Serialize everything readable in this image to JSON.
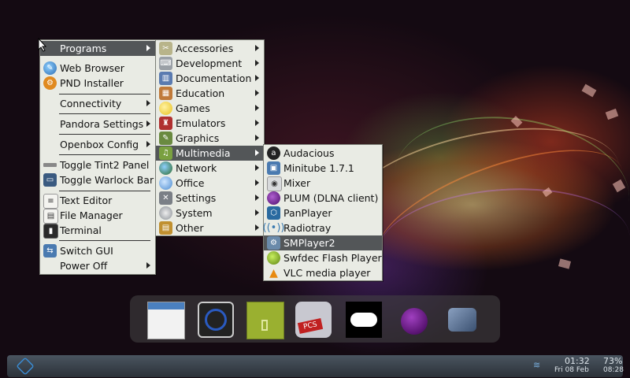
{
  "main_menu": {
    "items": [
      {
        "label": "Programs",
        "icon": "programs-icon",
        "submenu": true
      },
      {
        "label": "Web Browser",
        "icon": "web-browser-icon"
      },
      {
        "label": "PND Installer",
        "icon": "pnd-installer-icon"
      },
      {
        "label": "Connectivity",
        "submenu": true
      },
      {
        "label": "Pandora Settings",
        "submenu": true
      },
      {
        "label": "Openbox Config",
        "submenu": true
      },
      {
        "label": "Toggle Tint2 Panel",
        "icon": "panel-toggle-icon"
      },
      {
        "label": "Toggle Warlock Bar",
        "icon": "bar-toggle-icon"
      },
      {
        "label": "Text Editor",
        "icon": "text-editor-icon"
      },
      {
        "label": "File Manager",
        "icon": "file-manager-icon"
      },
      {
        "label": "Terminal",
        "icon": "terminal-icon"
      },
      {
        "label": "Switch GUI",
        "icon": "switch-gui-icon"
      },
      {
        "label": "Power Off",
        "submenu": true
      }
    ]
  },
  "programs_menu": {
    "items": [
      {
        "label": "Accessories",
        "icon": "accessories-icon",
        "color": "#b8b48a"
      },
      {
        "label": "Development",
        "icon": "development-icon",
        "color": "#9aa0a6"
      },
      {
        "label": "Documentation",
        "icon": "documentation-icon",
        "color": "#5a7bb0"
      },
      {
        "label": "Education",
        "icon": "education-icon",
        "color": "#c07a3a"
      },
      {
        "label": "Games",
        "icon": "games-icon",
        "color": "#e8c020"
      },
      {
        "label": "Emulators",
        "icon": "emulators-icon",
        "color": "#b03030"
      },
      {
        "label": "Graphics",
        "icon": "graphics-icon",
        "color": "#6a8a40"
      },
      {
        "label": "Multimedia",
        "icon": "multimedia-icon",
        "color": "#7aa040"
      },
      {
        "label": "Network",
        "icon": "network-icon",
        "color": "#3a78b0"
      },
      {
        "label": "Office",
        "icon": "office-icon",
        "color": "#4a8ad0"
      },
      {
        "label": "Settings",
        "icon": "settings-icon",
        "color": "#7a7f86"
      },
      {
        "label": "System",
        "icon": "system-icon",
        "color": "#8a8f96"
      },
      {
        "label": "Other",
        "icon": "other-icon",
        "color": "#c09030"
      }
    ],
    "selected": "Multimedia"
  },
  "multimedia_menu": {
    "items": [
      {
        "label": "Audacious",
        "icon": "audacious-icon",
        "color": "#222222"
      },
      {
        "label": "Minitube 1.7.1",
        "icon": "minitube-icon",
        "color": "#4a7ab0"
      },
      {
        "label": "Mixer",
        "icon": "mixer-icon",
        "color": "#9aa0a6"
      },
      {
        "label": "PLUM (DLNA client)",
        "icon": "plum-icon",
        "color": "#6a1a8a"
      },
      {
        "label": "PanPlayer",
        "icon": "panplayer-icon",
        "color": "#2a6aa0"
      },
      {
        "label": "Radiotray",
        "icon": "radiotray-icon",
        "color": "#3a7ab0"
      },
      {
        "label": "SMPlayer2",
        "icon": "smplayer-icon",
        "color": "#6a8aaa"
      },
      {
        "label": "Swfdec Flash Player",
        "icon": "swfdec-icon",
        "color": "#7aa020"
      },
      {
        "label": "VLC media player",
        "icon": "vlc-icon",
        "color": "#e88a10"
      }
    ],
    "selected": "SMPlayer2"
  },
  "dock": {
    "items": [
      "window-icon",
      "network-globe-icon",
      "archive-icon",
      "pcsx-icon",
      "gamepad-icon",
      "plum-icon",
      "smplayer-icon"
    ]
  },
  "panel": {
    "time": "01:32",
    "date": "Fri 08 Feb",
    "battery": "73%",
    "battery_time": "08:28"
  }
}
